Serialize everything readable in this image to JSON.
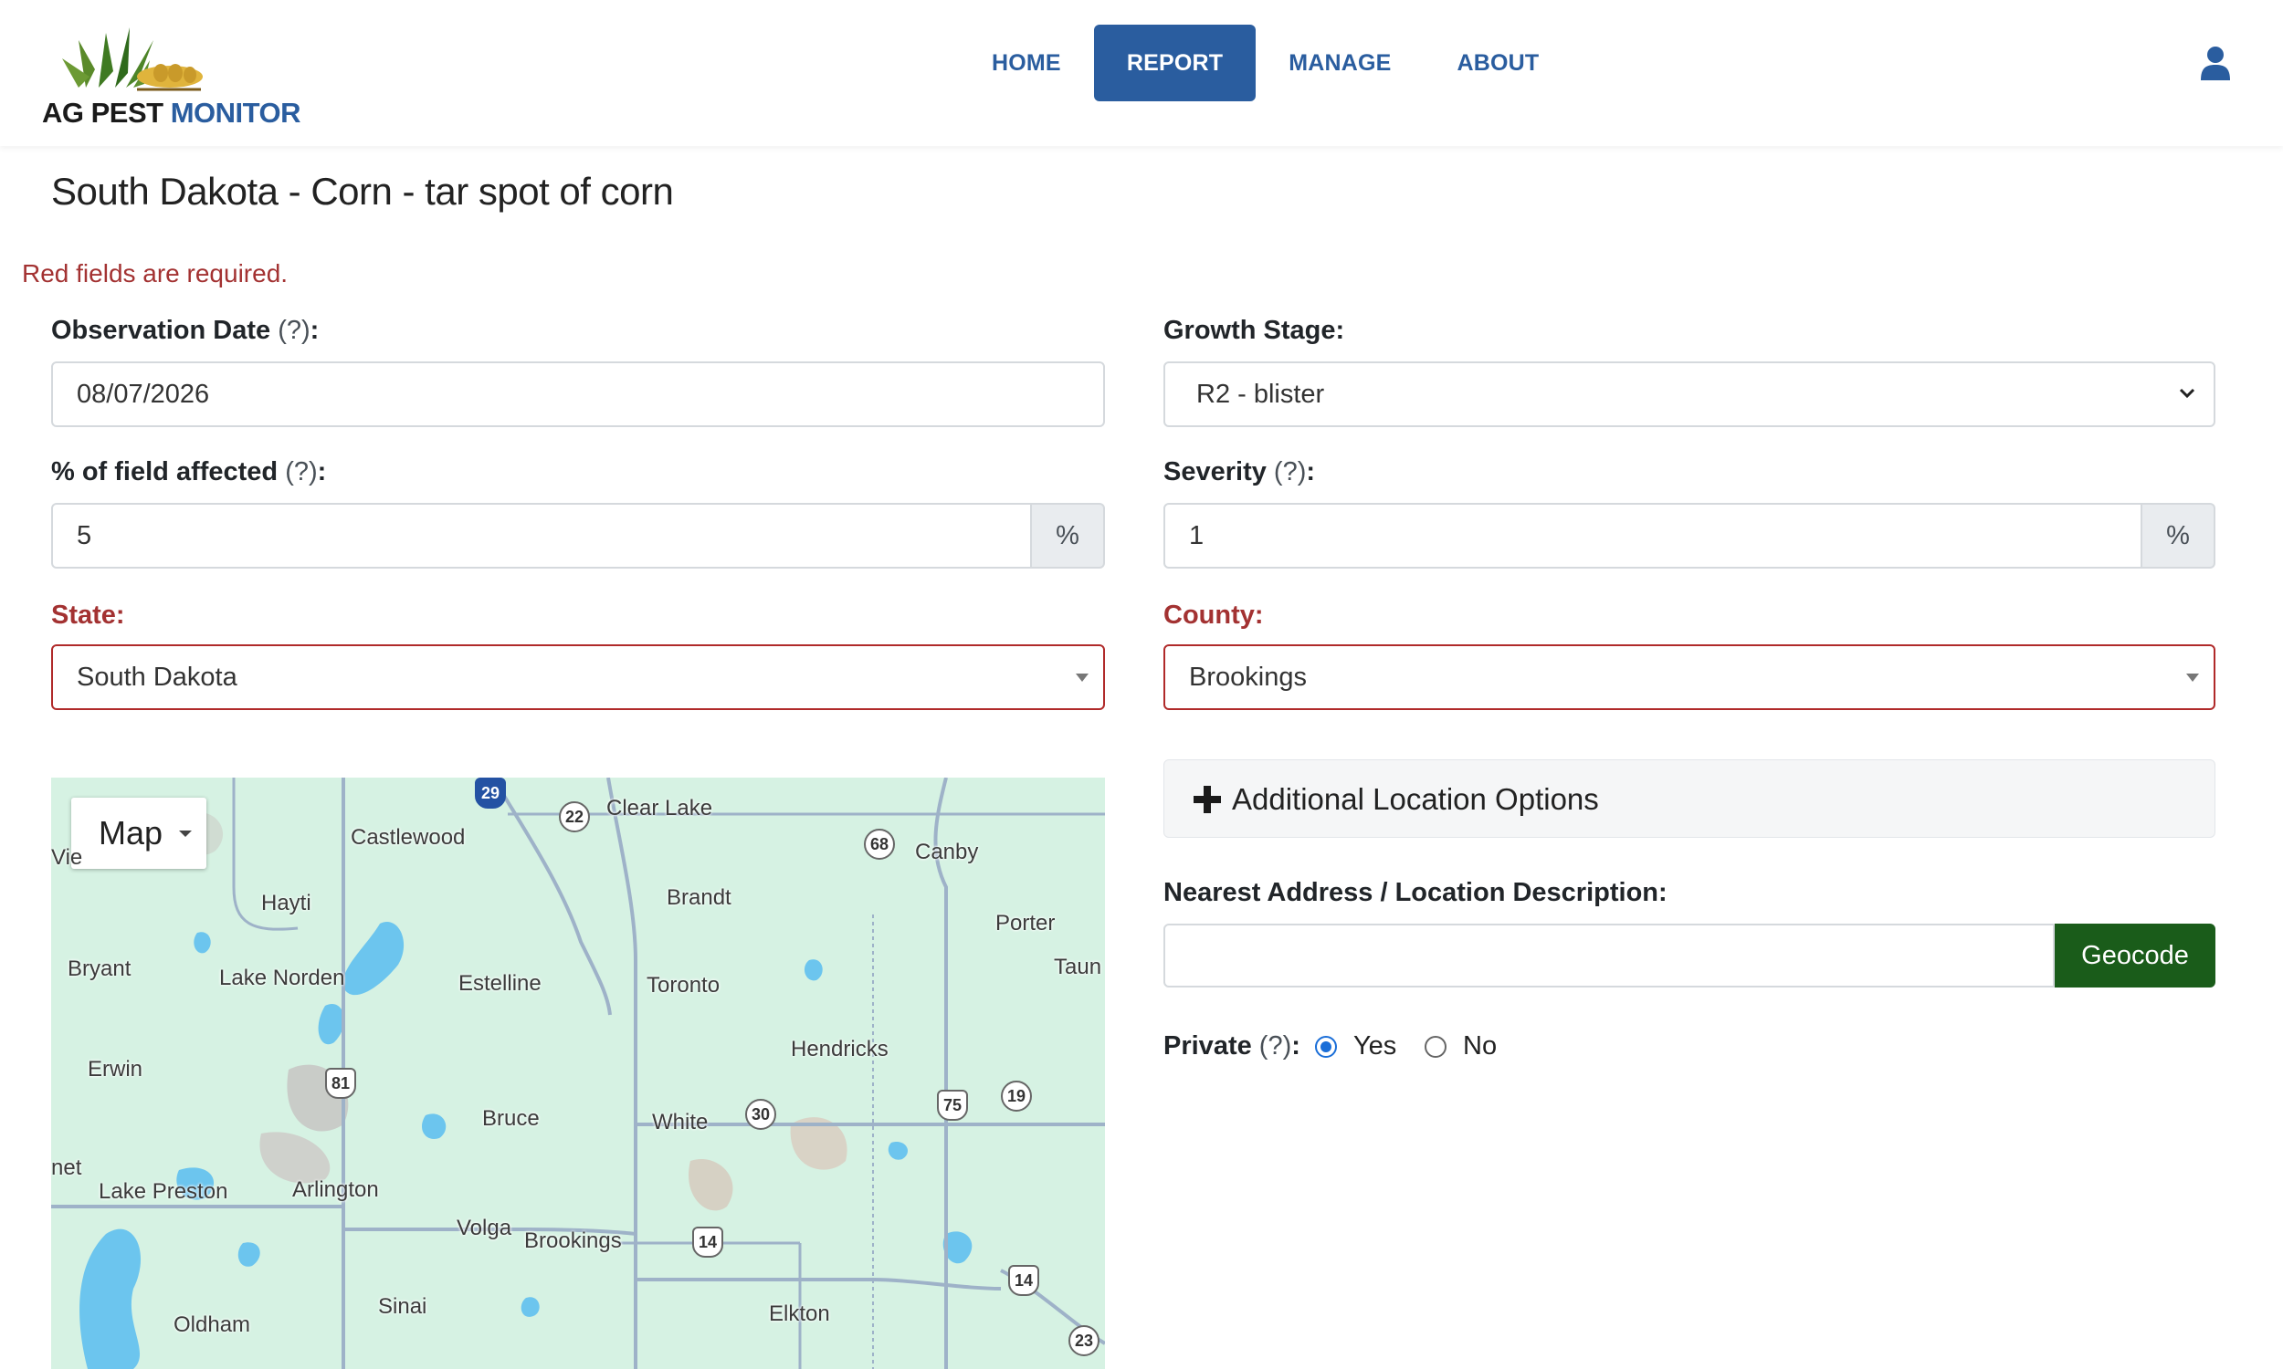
{
  "brand": {
    "text_ag_pest": "AG PEST ",
    "text_monitor": "MONITOR"
  },
  "nav": {
    "items": [
      {
        "label": "HOME",
        "active": false
      },
      {
        "label": "REPORT",
        "active": true
      },
      {
        "label": "MANAGE",
        "active": false
      },
      {
        "label": "ABOUT",
        "active": false
      }
    ]
  },
  "page": {
    "title": "South Dakota - Corn - tar spot of corn",
    "required_note": "Red fields are required."
  },
  "form": {
    "observation_date": {
      "label": "Observation Date",
      "help": "(?)",
      "suffix": ":",
      "value": "08/07/2026"
    },
    "growth_stage": {
      "label": "Growth Stage:",
      "value": "R2 - blister"
    },
    "field_affected": {
      "label": "% of field affected",
      "help": "(?)",
      "suffix": ":",
      "value": "5",
      "unit": "%"
    },
    "severity": {
      "label": "Severity",
      "help": "(?)",
      "suffix": ":",
      "value": "1",
      "unit": "%"
    },
    "state": {
      "label": "State:",
      "value": "South Dakota"
    },
    "county": {
      "label": "County:",
      "value": "Brookings"
    },
    "additional_location": {
      "label": "Additional Location Options"
    },
    "nearest_address": {
      "label": "Nearest Address / Location Description:",
      "value": "",
      "button": "Geocode"
    },
    "private": {
      "label": "Private",
      "help": "(?)",
      "suffix": ":",
      "options": [
        "Yes",
        "No"
      ],
      "selected": "Yes"
    }
  },
  "map": {
    "type_button": "Map",
    "towns": [
      "Castlewood",
      "Clear Lake",
      "Canby",
      "Hayti",
      "Brandt",
      "Porter",
      "Taun",
      "Bryant",
      "Lake Norden",
      "Estelline",
      "Toronto",
      "Hendricks",
      "Erwin",
      "Bruce",
      "White",
      "net",
      "Lake Preston",
      "Arlington",
      "Volga",
      "Brookings",
      "Sinai",
      "Oldham",
      "Elkton",
      "Vie"
    ],
    "shields": [
      "29",
      "22",
      "68",
      "81",
      "30",
      "75",
      "19",
      "14",
      "14",
      "23"
    ]
  },
  "colors": {
    "primary": "#2a5d9f",
    "required": "#a33232",
    "geocode": "#1a5c1a",
    "map_bg": "#d6f2e3",
    "water": "#6cc5ee"
  }
}
